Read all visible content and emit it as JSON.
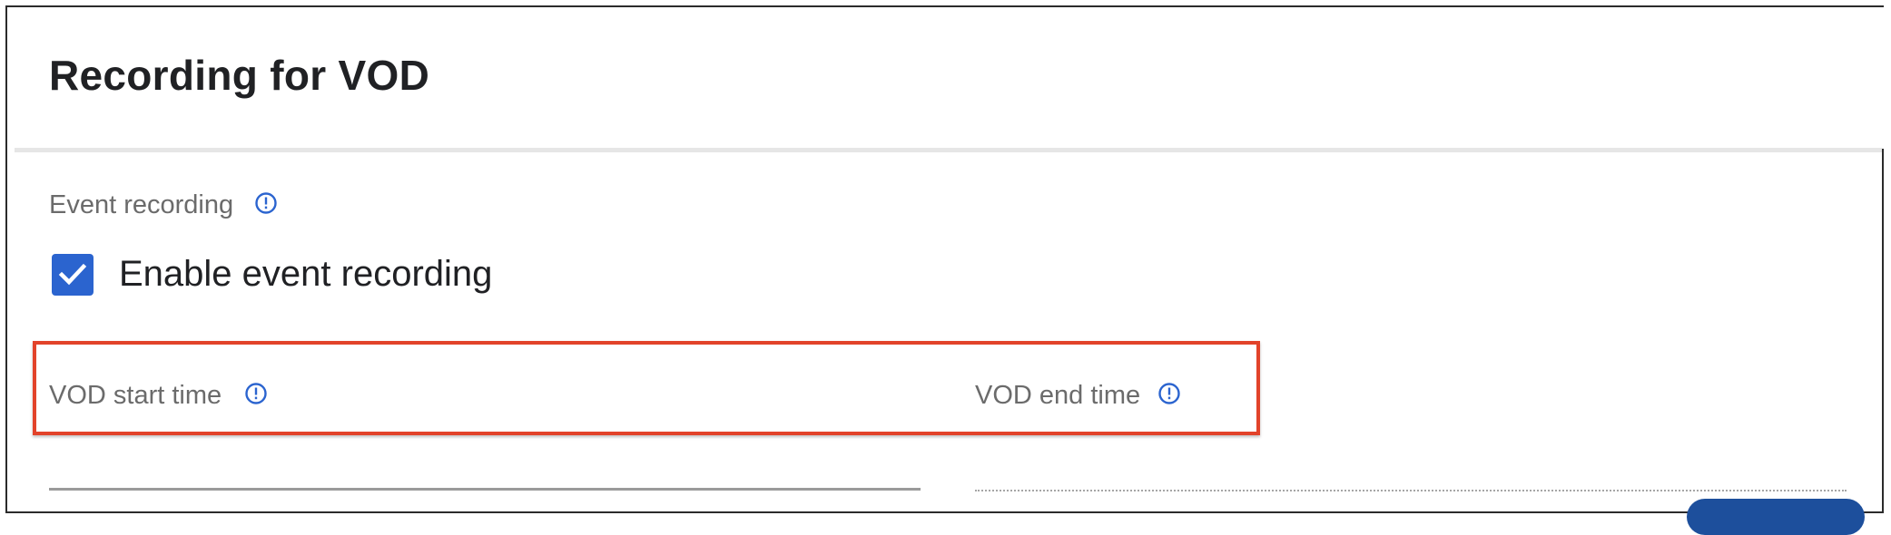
{
  "panel": {
    "title": "Recording for VOD"
  },
  "event_recording": {
    "section_label": "Event recording",
    "info_icon": "info-icon",
    "checkbox": {
      "label": "Enable event recording",
      "checked": true
    }
  },
  "vod_times": {
    "start_label": "VOD start time",
    "end_label": "VOD end time",
    "info_icon": "info-icon"
  },
  "colors": {
    "accent": "#2b64cf",
    "highlight_border": "#e2432a",
    "title_text": "#202124",
    "label_text": "#6b6b6b",
    "button": "#1d4f9c"
  }
}
